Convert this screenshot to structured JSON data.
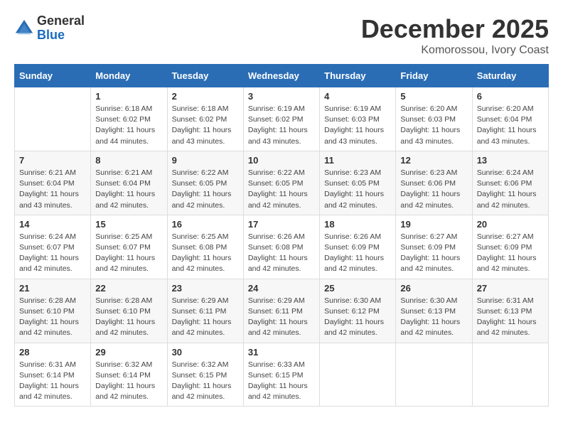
{
  "logo": {
    "general": "General",
    "blue": "Blue"
  },
  "header": {
    "month": "December 2025",
    "location": "Komorossou, Ivory Coast"
  },
  "days_of_week": [
    "Sunday",
    "Monday",
    "Tuesday",
    "Wednesday",
    "Thursday",
    "Friday",
    "Saturday"
  ],
  "weeks": [
    [
      {
        "day": "",
        "sunrise": "",
        "sunset": "",
        "daylight": ""
      },
      {
        "day": "1",
        "sunrise": "Sunrise: 6:18 AM",
        "sunset": "Sunset: 6:02 PM",
        "daylight": "Daylight: 11 hours and 44 minutes."
      },
      {
        "day": "2",
        "sunrise": "Sunrise: 6:18 AM",
        "sunset": "Sunset: 6:02 PM",
        "daylight": "Daylight: 11 hours and 43 minutes."
      },
      {
        "day": "3",
        "sunrise": "Sunrise: 6:19 AM",
        "sunset": "Sunset: 6:02 PM",
        "daylight": "Daylight: 11 hours and 43 minutes."
      },
      {
        "day": "4",
        "sunrise": "Sunrise: 6:19 AM",
        "sunset": "Sunset: 6:03 PM",
        "daylight": "Daylight: 11 hours and 43 minutes."
      },
      {
        "day": "5",
        "sunrise": "Sunrise: 6:20 AM",
        "sunset": "Sunset: 6:03 PM",
        "daylight": "Daylight: 11 hours and 43 minutes."
      },
      {
        "day": "6",
        "sunrise": "Sunrise: 6:20 AM",
        "sunset": "Sunset: 6:04 PM",
        "daylight": "Daylight: 11 hours and 43 minutes."
      }
    ],
    [
      {
        "day": "7",
        "sunrise": "Sunrise: 6:21 AM",
        "sunset": "Sunset: 6:04 PM",
        "daylight": "Daylight: 11 hours and 43 minutes."
      },
      {
        "day": "8",
        "sunrise": "Sunrise: 6:21 AM",
        "sunset": "Sunset: 6:04 PM",
        "daylight": "Daylight: 11 hours and 42 minutes."
      },
      {
        "day": "9",
        "sunrise": "Sunrise: 6:22 AM",
        "sunset": "Sunset: 6:05 PM",
        "daylight": "Daylight: 11 hours and 42 minutes."
      },
      {
        "day": "10",
        "sunrise": "Sunrise: 6:22 AM",
        "sunset": "Sunset: 6:05 PM",
        "daylight": "Daylight: 11 hours and 42 minutes."
      },
      {
        "day": "11",
        "sunrise": "Sunrise: 6:23 AM",
        "sunset": "Sunset: 6:05 PM",
        "daylight": "Daylight: 11 hours and 42 minutes."
      },
      {
        "day": "12",
        "sunrise": "Sunrise: 6:23 AM",
        "sunset": "Sunset: 6:06 PM",
        "daylight": "Daylight: 11 hours and 42 minutes."
      },
      {
        "day": "13",
        "sunrise": "Sunrise: 6:24 AM",
        "sunset": "Sunset: 6:06 PM",
        "daylight": "Daylight: 11 hours and 42 minutes."
      }
    ],
    [
      {
        "day": "14",
        "sunrise": "Sunrise: 6:24 AM",
        "sunset": "Sunset: 6:07 PM",
        "daylight": "Daylight: 11 hours and 42 minutes."
      },
      {
        "day": "15",
        "sunrise": "Sunrise: 6:25 AM",
        "sunset": "Sunset: 6:07 PM",
        "daylight": "Daylight: 11 hours and 42 minutes."
      },
      {
        "day": "16",
        "sunrise": "Sunrise: 6:25 AM",
        "sunset": "Sunset: 6:08 PM",
        "daylight": "Daylight: 11 hours and 42 minutes."
      },
      {
        "day": "17",
        "sunrise": "Sunrise: 6:26 AM",
        "sunset": "Sunset: 6:08 PM",
        "daylight": "Daylight: 11 hours and 42 minutes."
      },
      {
        "day": "18",
        "sunrise": "Sunrise: 6:26 AM",
        "sunset": "Sunset: 6:09 PM",
        "daylight": "Daylight: 11 hours and 42 minutes."
      },
      {
        "day": "19",
        "sunrise": "Sunrise: 6:27 AM",
        "sunset": "Sunset: 6:09 PM",
        "daylight": "Daylight: 11 hours and 42 minutes."
      },
      {
        "day": "20",
        "sunrise": "Sunrise: 6:27 AM",
        "sunset": "Sunset: 6:09 PM",
        "daylight": "Daylight: 11 hours and 42 minutes."
      }
    ],
    [
      {
        "day": "21",
        "sunrise": "Sunrise: 6:28 AM",
        "sunset": "Sunset: 6:10 PM",
        "daylight": "Daylight: 11 hours and 42 minutes."
      },
      {
        "day": "22",
        "sunrise": "Sunrise: 6:28 AM",
        "sunset": "Sunset: 6:10 PM",
        "daylight": "Daylight: 11 hours and 42 minutes."
      },
      {
        "day": "23",
        "sunrise": "Sunrise: 6:29 AM",
        "sunset": "Sunset: 6:11 PM",
        "daylight": "Daylight: 11 hours and 42 minutes."
      },
      {
        "day": "24",
        "sunrise": "Sunrise: 6:29 AM",
        "sunset": "Sunset: 6:11 PM",
        "daylight": "Daylight: 11 hours and 42 minutes."
      },
      {
        "day": "25",
        "sunrise": "Sunrise: 6:30 AM",
        "sunset": "Sunset: 6:12 PM",
        "daylight": "Daylight: 11 hours and 42 minutes."
      },
      {
        "day": "26",
        "sunrise": "Sunrise: 6:30 AM",
        "sunset": "Sunset: 6:13 PM",
        "daylight": "Daylight: 11 hours and 42 minutes."
      },
      {
        "day": "27",
        "sunrise": "Sunrise: 6:31 AM",
        "sunset": "Sunset: 6:13 PM",
        "daylight": "Daylight: 11 hours and 42 minutes."
      }
    ],
    [
      {
        "day": "28",
        "sunrise": "Sunrise: 6:31 AM",
        "sunset": "Sunset: 6:14 PM",
        "daylight": "Daylight: 11 hours and 42 minutes."
      },
      {
        "day": "29",
        "sunrise": "Sunrise: 6:32 AM",
        "sunset": "Sunset: 6:14 PM",
        "daylight": "Daylight: 11 hours and 42 minutes."
      },
      {
        "day": "30",
        "sunrise": "Sunrise: 6:32 AM",
        "sunset": "Sunset: 6:15 PM",
        "daylight": "Daylight: 11 hours and 42 minutes."
      },
      {
        "day": "31",
        "sunrise": "Sunrise: 6:33 AM",
        "sunset": "Sunset: 6:15 PM",
        "daylight": "Daylight: 11 hours and 42 minutes."
      },
      {
        "day": "",
        "sunrise": "",
        "sunset": "",
        "daylight": ""
      },
      {
        "day": "",
        "sunrise": "",
        "sunset": "",
        "daylight": ""
      },
      {
        "day": "",
        "sunrise": "",
        "sunset": "",
        "daylight": ""
      }
    ]
  ]
}
